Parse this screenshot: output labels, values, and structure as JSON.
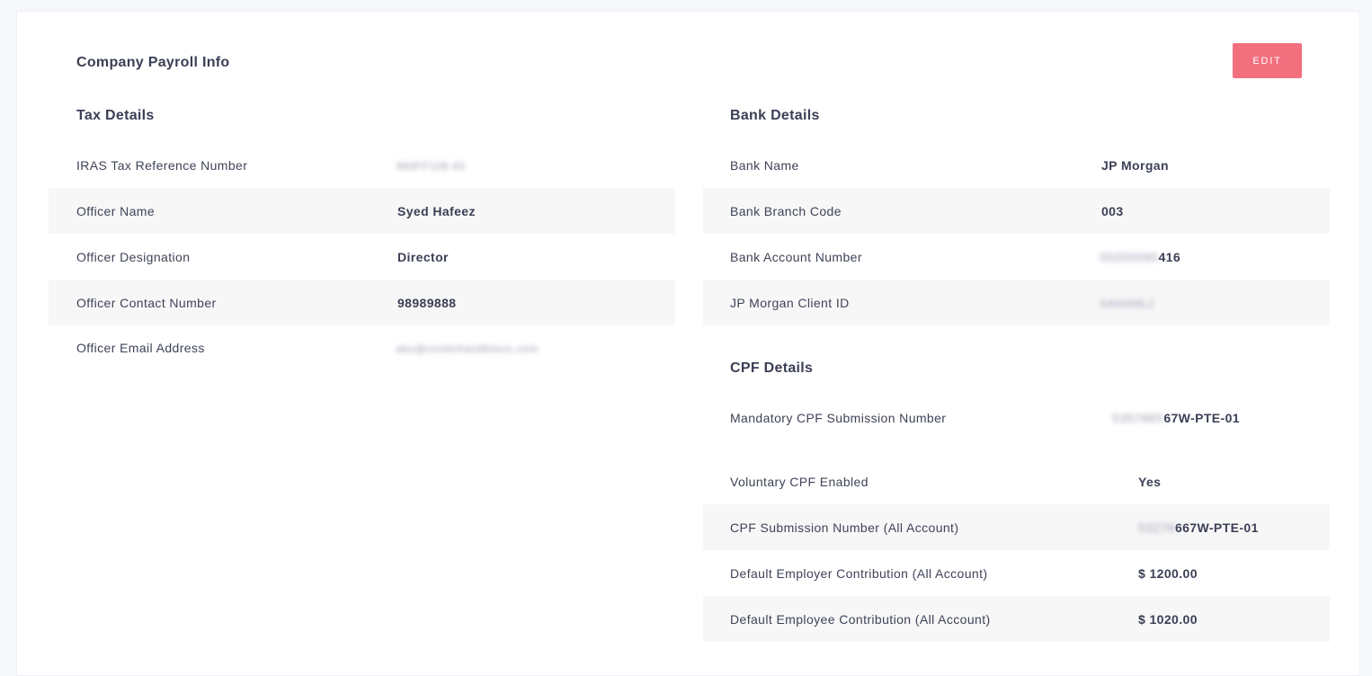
{
  "header": {
    "title": "Company Payroll Info",
    "edit_label": "EDIT"
  },
  "tax": {
    "title": "Tax Details",
    "rows": [
      {
        "label": "IRAS Tax Reference Number",
        "value": "984FF106 43"
      },
      {
        "label": "Officer Name",
        "value": "Syed Hafeez"
      },
      {
        "label": "Officer Designation",
        "value": "Director"
      },
      {
        "label": "Officer Contact Number",
        "value": "98989888"
      },
      {
        "label": "Officer Email Address",
        "value": "abu@centerhandlinesc.com"
      }
    ]
  },
  "bank": {
    "title": "Bank Details",
    "rows": [
      {
        "label": "Bank Name",
        "value": "JP Morgan"
      },
      {
        "label": "Bank Branch Code",
        "value": "003"
      },
      {
        "label": "Bank Account Number",
        "value_hidden": "00200090",
        "value_visible": "416"
      },
      {
        "label": "JP Morgan Client ID",
        "value": "SAN009L2"
      }
    ]
  },
  "cpf": {
    "title": "CPF Details",
    "rows": [
      {
        "label": "Mandatory CPF Submission Number",
        "value_hidden": "5357865",
        "value_visible": "67W-PTE-01"
      },
      {
        "label": "Voluntary CPF Enabled",
        "value": "Yes"
      },
      {
        "label": "CPF Submission Number (All Account)",
        "value_hidden": "53278",
        "value_visible": "667W-PTE-01"
      },
      {
        "label": "Default Employer Contribution (All Account)",
        "value": "$ 1200.00"
      },
      {
        "label": "Default Employee Contribution (All Account)",
        "value": "$ 1020.00"
      }
    ]
  }
}
